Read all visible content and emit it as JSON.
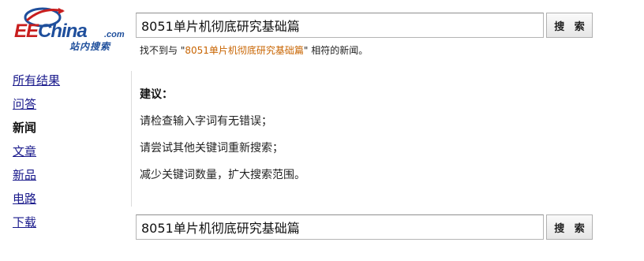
{
  "logo": {
    "main_red": "EE",
    "main_blue": "China",
    "dotcom": ".com",
    "sub": "站内搜索"
  },
  "search": {
    "query": "8051单片机彻底研究基础篇",
    "button_label": "搜 索"
  },
  "notice": {
    "prefix": "找不到与 \"",
    "query": "8051单片机彻底研究基础篇",
    "suffix": "\" 相符的新闻。"
  },
  "sidebar": {
    "items": [
      {
        "label": "所有结果",
        "active": false
      },
      {
        "label": "问答",
        "active": false
      },
      {
        "label": "新闻",
        "active": true
      },
      {
        "label": "文章",
        "active": false
      },
      {
        "label": "新品",
        "active": false
      },
      {
        "label": "电路",
        "active": false
      },
      {
        "label": "下载",
        "active": false
      }
    ]
  },
  "suggestions": {
    "title": "建议：",
    "lines": [
      "请检查输入字词有无错误；",
      "请尝试其他关键词重新搜索；",
      "减少关键词数量，扩大搜索范围。"
    ]
  },
  "colors": {
    "brand_red": "#c81e1e",
    "brand_blue": "#1f4f9c",
    "link": "#1a1a8c",
    "highlight": "#c86400"
  }
}
